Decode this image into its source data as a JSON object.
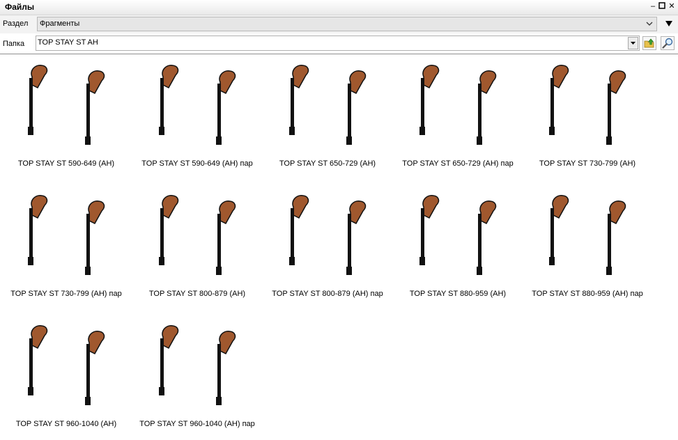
{
  "window": {
    "title": "Файлы"
  },
  "section": {
    "label": "Раздел",
    "value": "Фрагменты"
  },
  "folder": {
    "label": "Папка",
    "value": "TOP STAY ST AH"
  },
  "items": [
    {
      "label": "TOP STAY ST 590-649 (AH)"
    },
    {
      "label": "TOP STAY ST 590-649 (AH) пар"
    },
    {
      "label": "TOP STAY ST 650-729 (AH)"
    },
    {
      "label": "TOP STAY ST 650-729 (AH) пар"
    },
    {
      "label": "TOP STAY ST 730-799 (AH)"
    },
    {
      "label": "TOP STAY ST 730-799 (AH) пар"
    },
    {
      "label": "TOP STAY ST 800-879 (AH)"
    },
    {
      "label": "TOP STAY ST 800-879 (AH) пар"
    },
    {
      "label": "TOP STAY ST 880-959 (AH)"
    },
    {
      "label": "TOP STAY ST 880-959 (AH) пар"
    },
    {
      "label": "TOP STAY ST 960-1040 (AH)"
    },
    {
      "label": "TOP STAY ST 960-1040 (AH) пар"
    }
  ],
  "icons": {
    "minimize": "minimize-icon",
    "maximize": "maximize-icon",
    "close": "close-icon",
    "section_dropdown": "chevron-down-icon",
    "section_menu": "triangle-down-icon",
    "folder_up": "folder-up-icon",
    "search": "magnifier-icon"
  },
  "colors": {
    "stay_head": "#a0582e",
    "stay_bar": "#111111"
  }
}
